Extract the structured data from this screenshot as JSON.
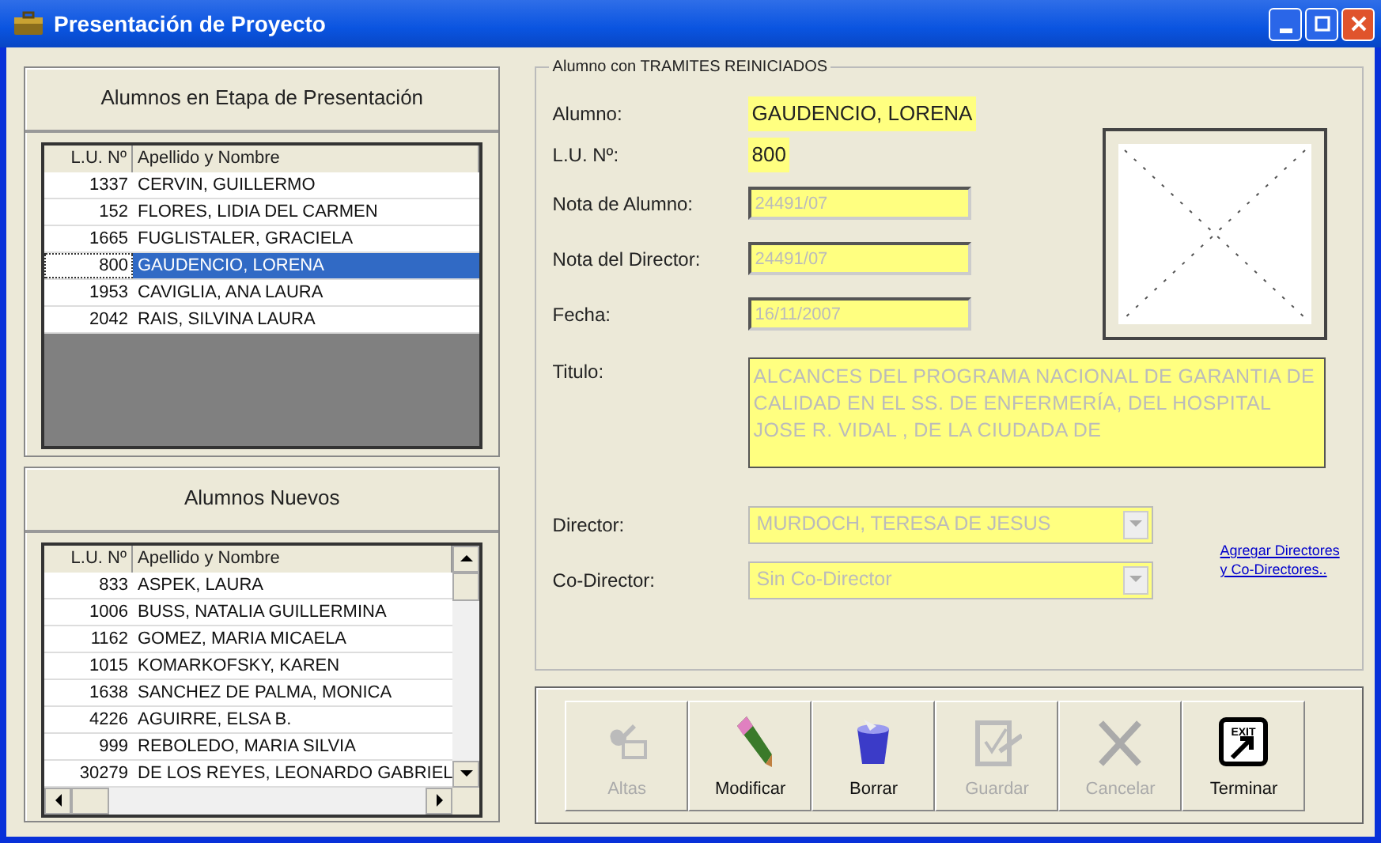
{
  "window": {
    "title": "Presentación de Proyecto"
  },
  "presentation_list": {
    "title": "Alumnos en Etapa de Presentación",
    "columns": [
      "L.U. Nº",
      "Apellido y Nombre"
    ],
    "rows": [
      {
        "lu": "1337",
        "name": "CERVIN, GUILLERMO",
        "selected": false
      },
      {
        "lu": "152",
        "name": "FLORES, LIDIA DEL CARMEN",
        "selected": false
      },
      {
        "lu": "1665",
        "name": "FUGLISTALER, GRACIELA",
        "selected": false
      },
      {
        "lu": "800",
        "name": "GAUDENCIO, LORENA",
        "selected": true
      },
      {
        "lu": "1953",
        "name": "CAVIGLIA, ANA LAURA",
        "selected": false
      },
      {
        "lu": "2042",
        "name": "RAIS, SILVINA LAURA",
        "selected": false
      }
    ]
  },
  "new_list": {
    "title": "Alumnos Nuevos",
    "columns": [
      "L.U. Nº",
      "Apellido y Nombre"
    ],
    "rows": [
      {
        "lu": "833",
        "name": "ASPEK, LAURA",
        "selected": false
      },
      {
        "lu": "1006",
        "name": "BUSS, NATALIA GUILLERMINA",
        "selected": false
      },
      {
        "lu": "1162",
        "name": "GOMEZ, MARIA MICAELA",
        "selected": false
      },
      {
        "lu": "1015",
        "name": "KOMARKOFSKY, KAREN",
        "selected": false
      },
      {
        "lu": "1638",
        "name": "SANCHEZ DE PALMA, MONICA",
        "selected": false
      },
      {
        "lu": "4226",
        "name": "AGUIRRE, ELSA B.",
        "selected": false
      },
      {
        "lu": "999",
        "name": "REBOLEDO, MARIA SILVIA",
        "selected": false
      },
      {
        "lu": "30279",
        "name": "DE LOS REYES, LEONARDO GABRIEL",
        "selected": false
      }
    ]
  },
  "detail": {
    "legend": "Alumno con TRAMITES REINICIADOS",
    "fields": [
      {
        "kind": "highlight",
        "label": "Alumno:",
        "value": "GAUDENCIO, LORENA",
        "disabled": false
      },
      {
        "kind": "highlight",
        "label": "L.U. Nº:",
        "value": "800",
        "disabled": false
      },
      {
        "kind": "input",
        "label": "Nota de Alumno:",
        "value": "24491/07",
        "disabled": true
      },
      {
        "kind": "input",
        "label": "Nota del Director:",
        "value": "24491/07",
        "disabled": true
      },
      {
        "kind": "input",
        "label": "Fecha:",
        "value": "16/11/2007",
        "disabled": true
      },
      {
        "kind": "textarea",
        "label": "Titulo:",
        "value": "ALCANCES DEL PROGRAMA NACIONAL DE GARANTIA DE CALIDAD EN EL SS. DE ENFERMERÍA, DEL HOSPITAL JOSE R. VIDAL , DE LA CIUDADA DE",
        "disabled": true
      },
      {
        "kind": "select",
        "label": "Director:",
        "value": "MURDOCH, TERESA DE JESUS",
        "disabled": true
      },
      {
        "kind": "select",
        "label": "Co-Director:",
        "value": "Sin Co-Director",
        "disabled": true
      }
    ],
    "link": "Agregar Directores y Co-Directores.."
  },
  "buttons": [
    {
      "kind": "add",
      "label": "Altas",
      "disabled": true
    },
    {
      "kind": "edit",
      "label": "Modificar",
      "disabled": false
    },
    {
      "kind": "delete",
      "label": "Borrar",
      "disabled": false
    },
    {
      "kind": "save",
      "label": "Guardar",
      "disabled": true
    },
    {
      "kind": "cancel",
      "label": "Cancelar",
      "disabled": true
    },
    {
      "kind": "exit",
      "label": "Terminar",
      "disabled": false,
      "icon_text": "EXIT"
    }
  ]
}
